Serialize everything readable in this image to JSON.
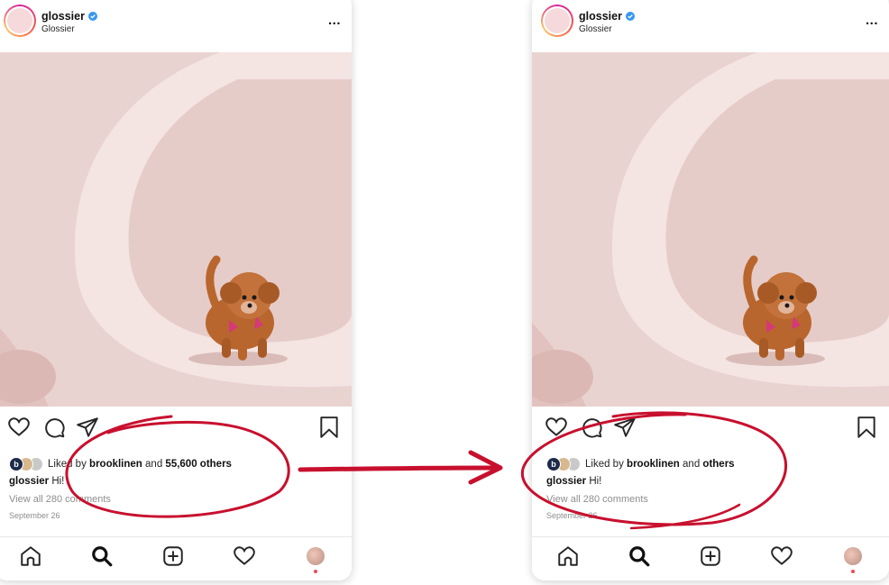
{
  "posts": [
    {
      "username": "glossier",
      "subname": "Glossier",
      "more_label": "...",
      "likes_prefix": "Liked by",
      "liked_by_user": "brooklinen",
      "likes_joiner": "and",
      "likes_others": "55,600 others",
      "caption_user": "glossier",
      "caption_text": "Hi!",
      "view_comments": "View all 280 comments",
      "date": "September 26",
      "mini_avatar_letter": "b"
    },
    {
      "username": "glossier",
      "subname": "Glossier",
      "more_label": "...",
      "likes_prefix": "Liked by",
      "liked_by_user": "brooklinen",
      "likes_joiner": "and",
      "likes_others": "others",
      "caption_user": "glossier",
      "caption_text": "Hi!",
      "view_comments": "View all 280 comments",
      "date": "September 26",
      "mini_avatar_letter": "b"
    }
  ],
  "icons": {
    "post_actions": [
      "heart-icon",
      "comment-icon",
      "share-icon",
      "bookmark-icon"
    ],
    "tabbar": [
      "home-icon",
      "search-icon",
      "new-post-icon",
      "activity-heart-icon",
      "profile-avatar"
    ]
  },
  "colors": {
    "annotation_red": "#c8102e",
    "verified_blue": "#3897f0",
    "notification_dot": "#ed4956",
    "photo_background": "#ecd6d3"
  }
}
